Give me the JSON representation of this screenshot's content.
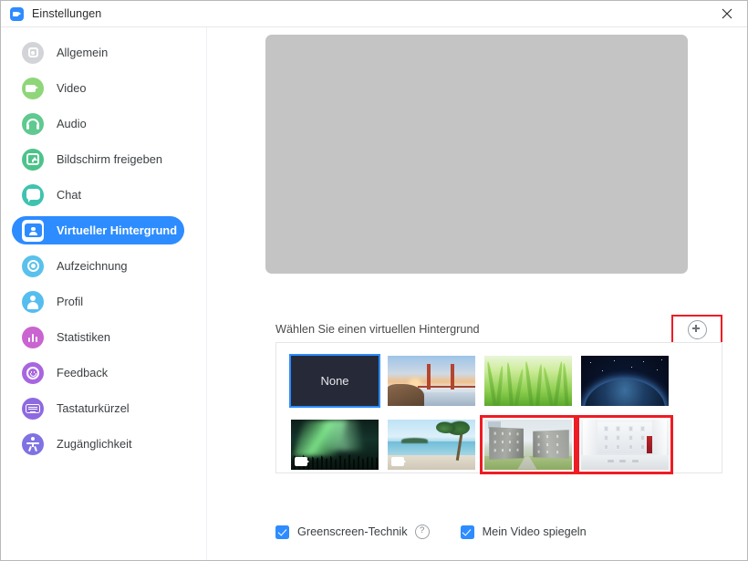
{
  "window": {
    "title": "Einstellungen",
    "app_icon": "zoom-camera-icon",
    "close_icon": "close-icon"
  },
  "sidebar": {
    "items": [
      {
        "label": "Allgemein",
        "icon": "gear-icon",
        "active": false
      },
      {
        "label": "Video",
        "icon": "video-camera-icon",
        "active": false
      },
      {
        "label": "Audio",
        "icon": "headset-icon",
        "active": false
      },
      {
        "label": "Bildschirm freigeben",
        "icon": "screen-share-icon",
        "active": false
      },
      {
        "label": "Chat",
        "icon": "chat-bubble-icon",
        "active": false
      },
      {
        "label": "Virtueller Hintergrund",
        "icon": "person-card-icon",
        "active": true
      },
      {
        "label": "Aufzeichnung",
        "icon": "record-target-icon",
        "active": false
      },
      {
        "label": "Profil",
        "icon": "person-icon",
        "active": false
      },
      {
        "label": "Statistiken",
        "icon": "bar-chart-icon",
        "active": false
      },
      {
        "label": "Feedback",
        "icon": "smiley-icon",
        "active": false
      },
      {
        "label": "Tastaturkürzel",
        "icon": "keyboard-icon",
        "active": false
      },
      {
        "label": "Zugänglichkeit",
        "icon": "accessibility-icon",
        "active": false
      }
    ]
  },
  "main": {
    "preview_label": "video-preview",
    "section_title": "Wählen Sie einen virtuellen Hintergrund",
    "add_button": {
      "icon": "plus-circle-icon",
      "highlighted": true,
      "highlight_color": "#ee1c24"
    },
    "backgrounds": [
      {
        "label": "None",
        "art": "none",
        "selected": true,
        "video": false,
        "highlighted": false
      },
      {
        "label": "Golden Gate",
        "art": "bridge",
        "selected": false,
        "video": false,
        "highlighted": false
      },
      {
        "label": "Gras",
        "art": "grass",
        "selected": false,
        "video": false,
        "highlighted": false
      },
      {
        "label": "Erde aus dem All",
        "art": "space",
        "selected": false,
        "video": false,
        "highlighted": false
      },
      {
        "label": "Polarlicht",
        "art": "aurora",
        "selected": false,
        "video": true,
        "highlighted": false
      },
      {
        "label": "Strand",
        "art": "beach",
        "selected": false,
        "video": true,
        "highlighted": false
      },
      {
        "label": "Gebäude außen",
        "art": "bldg",
        "selected": false,
        "video": false,
        "highlighted": true
      },
      {
        "label": "Atrium innen",
        "art": "atrium",
        "selected": false,
        "video": false,
        "highlighted": true
      }
    ],
    "options": [
      {
        "label": "Greenscreen-Technik",
        "checked": true,
        "help": "?"
      },
      {
        "label": "Mein Video spiegeln",
        "checked": true
      }
    ]
  },
  "colors": {
    "accent": "#2d8cff",
    "highlight": "#ee1c24",
    "preview_bg": "#c4c4c4",
    "text": "#3c4043"
  }
}
